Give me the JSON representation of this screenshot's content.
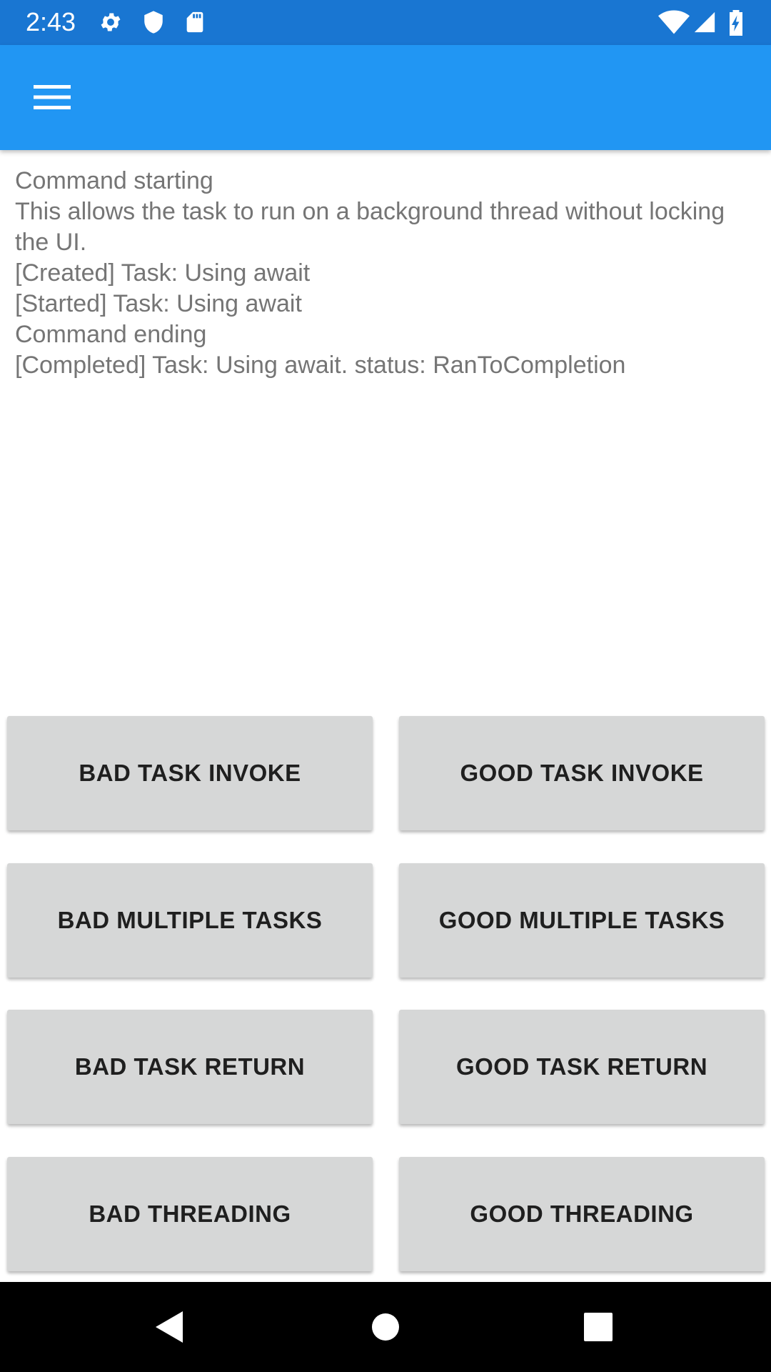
{
  "status_bar": {
    "time": "2:43",
    "icons": [
      "gear-icon",
      "shield-icon",
      "sd-card-icon",
      "wifi-icon",
      "cell-signal-icon",
      "battery-charging-icon"
    ],
    "bg_color": "#1976D2"
  },
  "app_bar": {
    "menu_icon": "hamburger-menu-icon",
    "bg_color": "#2196F3"
  },
  "log": {
    "lines": [
      "Command starting",
      "This allows the task to run on a background thread without locking the UI.",
      "[Created] Task: Using await",
      "[Started] Task: Using await",
      "Command ending",
      "[Completed] Task: Using await. status: RanToCompletion"
    ]
  },
  "buttons": {
    "bad_task_invoke": "BAD TASK INVOKE",
    "good_task_invoke": "GOOD TASK INVOKE",
    "bad_multiple_tasks": "BAD MULTIPLE TASKS",
    "good_multiple_tasks": "GOOD MULTIPLE TASKS",
    "bad_task_return": "BAD TASK RETURN",
    "good_task_return": "GOOD TASK RETURN",
    "bad_threading": "BAD THREADING",
    "good_threading": "GOOD THREADING"
  },
  "nav_bar": {
    "icons": [
      "back-icon",
      "home-icon",
      "recents-icon"
    ]
  }
}
